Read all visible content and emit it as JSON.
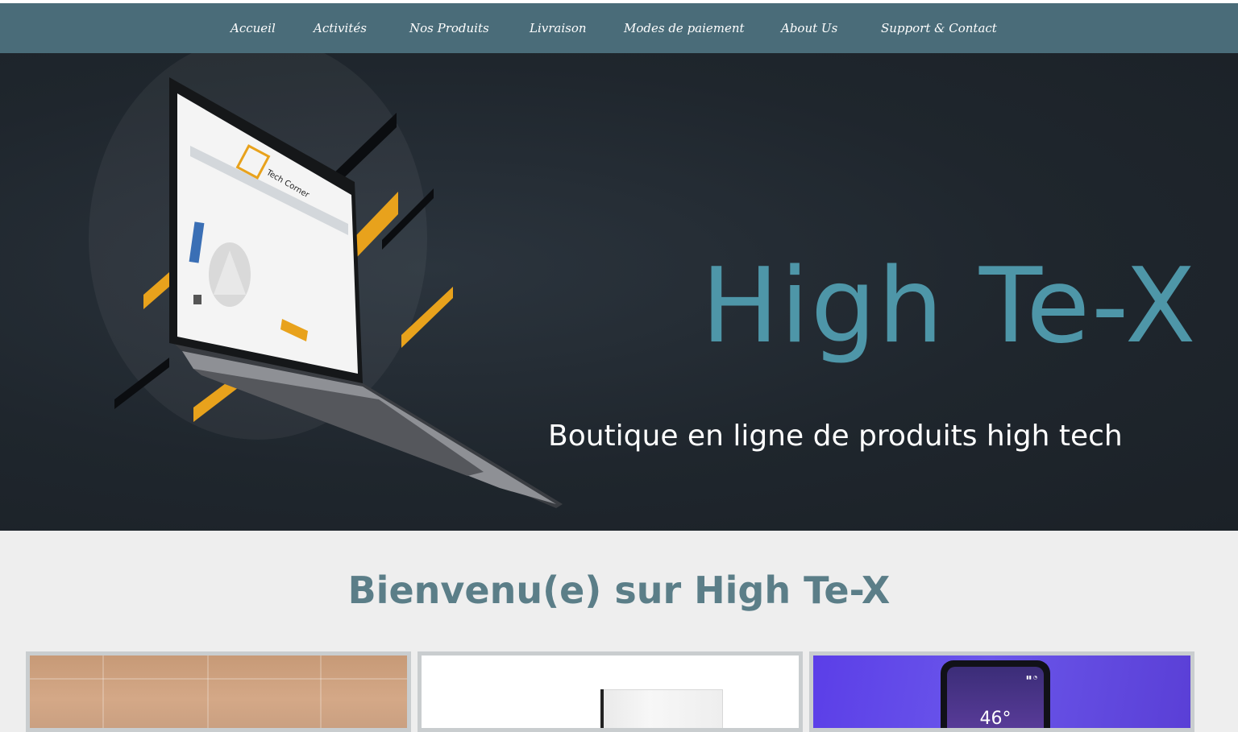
{
  "nav": {
    "items": [
      {
        "label": "Accueil"
      },
      {
        "label": "Activités"
      },
      {
        "label": "Nos Produits"
      },
      {
        "label": "Livraison"
      },
      {
        "label": "Modes de paiement"
      },
      {
        "label": "About Us"
      },
      {
        "label": "Support & Contact"
      }
    ]
  },
  "hero": {
    "title": "High Te-X",
    "subtitle": "Boutique en ligne de produits high tech",
    "laptop_screen_brand": "Tech Corner",
    "illustration": "laptop-illustration"
  },
  "welcome": {
    "heading": "Bienvenu(e) sur High Te-X"
  },
  "cards": [
    {
      "name": "product-card-1"
    },
    {
      "name": "product-card-2"
    },
    {
      "name": "product-card-3",
      "phone_temperature": "46°"
    }
  ],
  "colors": {
    "nav_background": "#4a6c79",
    "hero_background": "#1f262d",
    "accent": "#4e96a8",
    "welcome_heading": "#5b7e88",
    "stripe_yellow": "#e8a21c"
  }
}
